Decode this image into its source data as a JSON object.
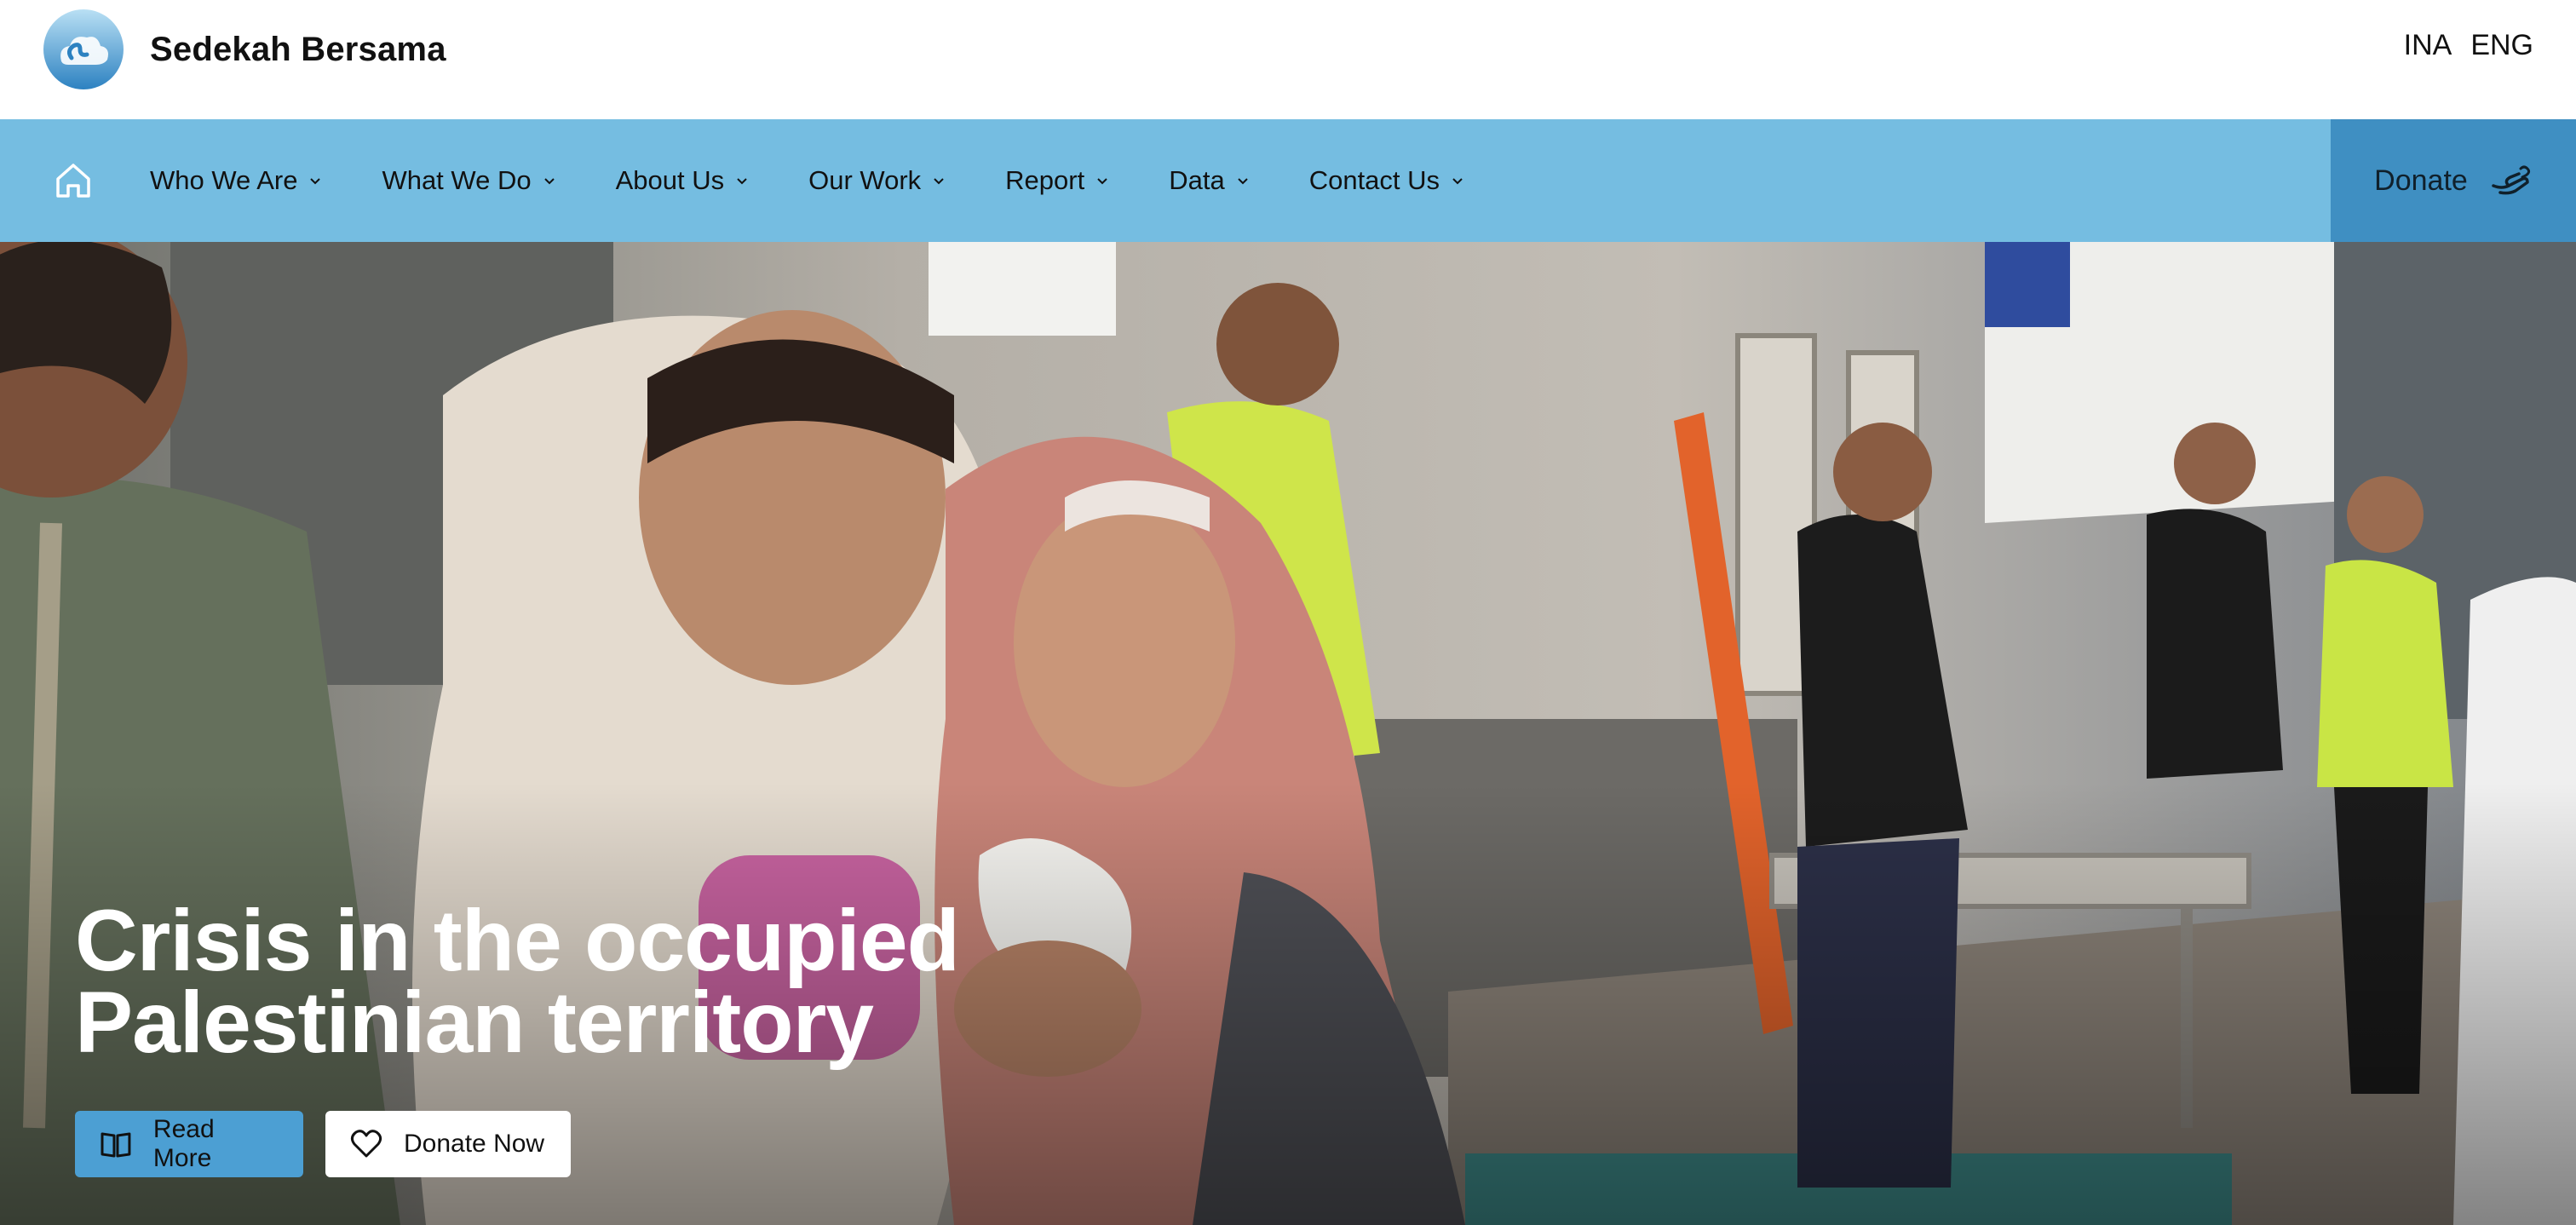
{
  "brand": {
    "name": "Sedekah Bersama",
    "logo_icon": "cloud-logo-icon",
    "colors": {
      "logo_light": "#9fd3ef",
      "logo_dark": "#2d82c1"
    }
  },
  "languages": [
    "INA",
    "ENG"
  ],
  "nav": {
    "home_icon": "home-icon",
    "items": [
      {
        "label": "Who We Are"
      },
      {
        "label": "What We Do"
      },
      {
        "label": "About Us"
      },
      {
        "label": "Our Work"
      },
      {
        "label": "Report"
      },
      {
        "label": "Data"
      },
      {
        "label": "Contact Us"
      }
    ],
    "donate_label": "Donate",
    "donate_icon": "hand-heart-icon",
    "colors": {
      "bar": "#75bde1",
      "donate_bg": "#3f8fc2"
    }
  },
  "hero": {
    "title_line1": "Crisis in the occupied",
    "title_line2": "Palestinian territory",
    "read_more_label": "Read More",
    "read_more_icon": "book-open-icon",
    "donate_now_label": "Donate Now",
    "donate_now_icon": "heart-icon",
    "image_subject": "photo-women-embracing-in-crowd"
  }
}
